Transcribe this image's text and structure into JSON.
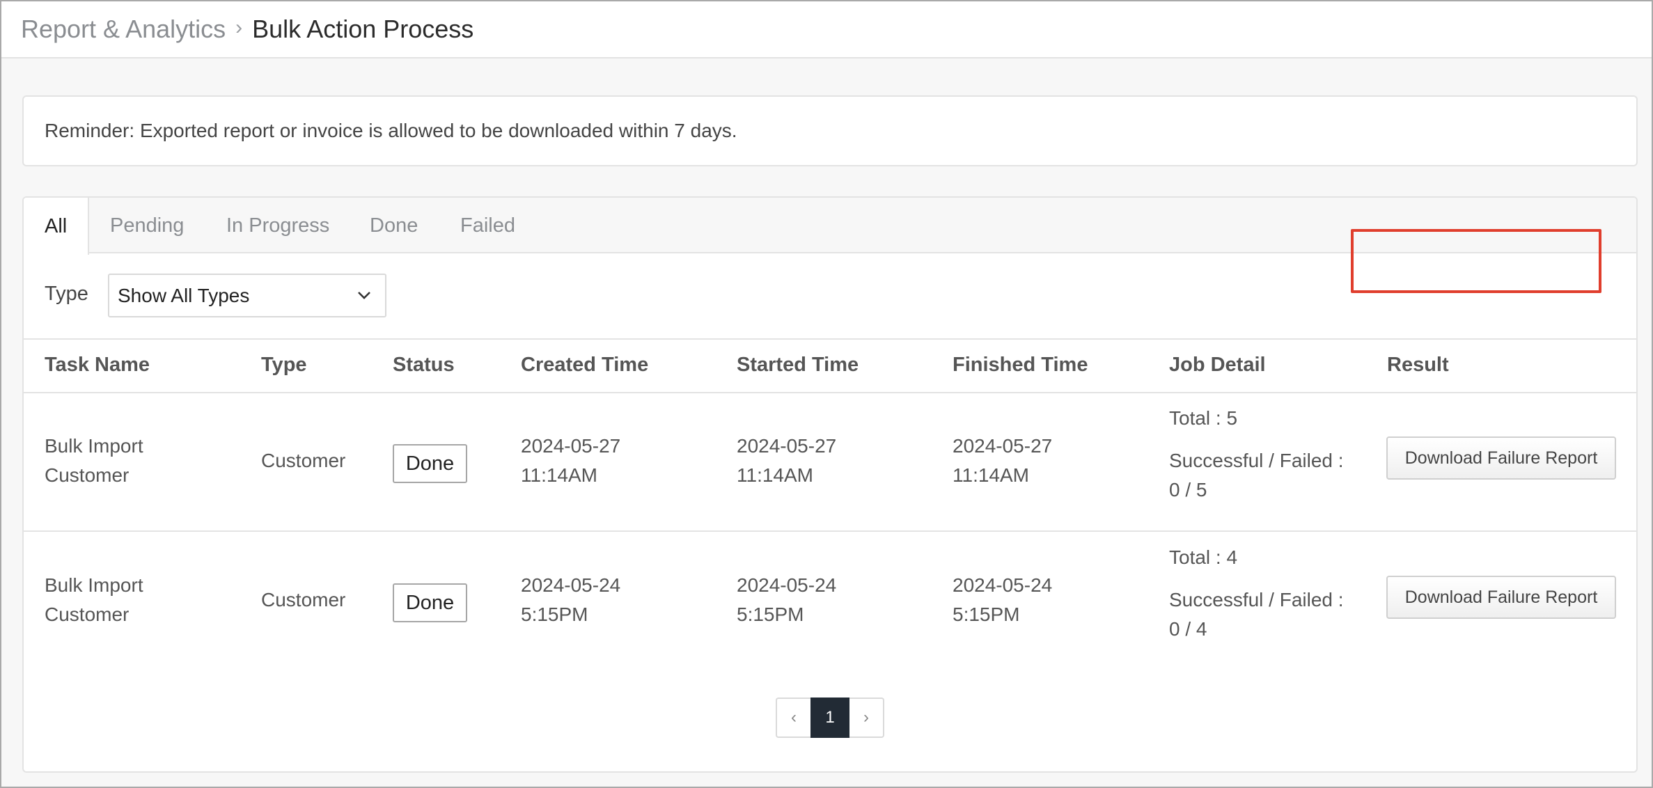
{
  "breadcrumb": {
    "parent": "Report & Analytics",
    "separator": "›",
    "current": "Bulk Action Process"
  },
  "reminder": {
    "text": "Reminder: Exported report or invoice is allowed to be downloaded within 7 days."
  },
  "tabs": [
    {
      "label": "All",
      "active": true
    },
    {
      "label": "Pending",
      "active": false
    },
    {
      "label": "In Progress",
      "active": false
    },
    {
      "label": "Done",
      "active": false
    },
    {
      "label": "Failed",
      "active": false
    }
  ],
  "filter": {
    "label": "Type",
    "selected": "Show All Types"
  },
  "table": {
    "headers": [
      "Task Name",
      "Type",
      "Status",
      "Created Time",
      "Started Time",
      "Finished Time",
      "Job Detail",
      "Result"
    ],
    "rows": [
      {
        "task_name_1": "Bulk Import",
        "task_name_2": "Customer",
        "type": "Customer",
        "status": "Done",
        "created_date": "2024-05-27",
        "created_time": "11:14AM",
        "started_date": "2024-05-27",
        "started_time": "11:14AM",
        "finished_date": "2024-05-27",
        "finished_time": "11:14AM",
        "total": "Total : 5",
        "sf_label": "Successful / Failed :",
        "sf_value": "0 / 5",
        "result_button": "Download Failure Report"
      },
      {
        "task_name_1": "Bulk Import",
        "task_name_2": "Customer",
        "type": "Customer",
        "status": "Done",
        "created_date": "2024-05-24",
        "created_time": "5:15PM",
        "started_date": "2024-05-24",
        "started_time": "5:15PM",
        "finished_date": "2024-05-24",
        "finished_time": "5:15PM",
        "total": "Total : 4",
        "sf_label": "Successful / Failed :",
        "sf_value": "0 / 4",
        "result_button": "Download Failure Report"
      }
    ]
  },
  "pagination": {
    "prev": "‹",
    "current": "1",
    "next": "›"
  },
  "colors": {
    "highlight": "#e03e2d",
    "active_page": "#222b35"
  }
}
